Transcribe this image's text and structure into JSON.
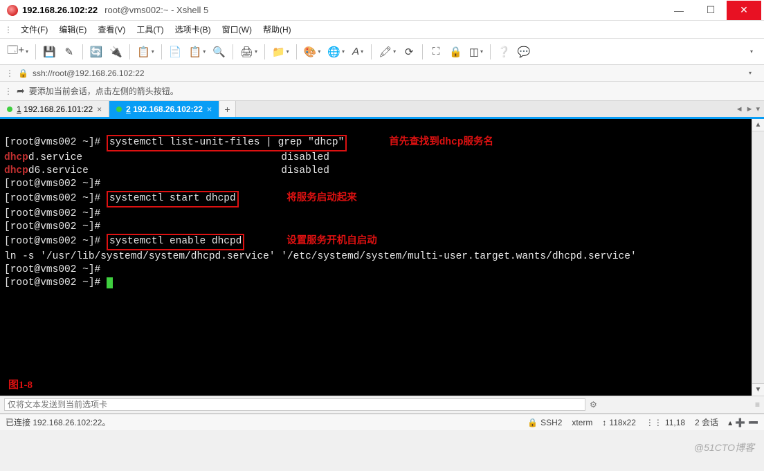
{
  "window": {
    "title": "192.168.26.102:22",
    "subtitle": "root@vms002:~ - Xshell 5"
  },
  "menus": [
    "文件(F)",
    "编辑(E)",
    "查看(V)",
    "工具(T)",
    "选项卡(B)",
    "窗口(W)",
    "帮助(H)"
  ],
  "address": "ssh://root@192.168.26.102:22",
  "hint": "要添加当前会话，点击左侧的箭头按钮。",
  "tabs": [
    {
      "num": "1",
      "label": "192.168.26.101:22",
      "active": false
    },
    {
      "num": "2",
      "label": "192.168.26.102:22",
      "active": true
    }
  ],
  "terminal": {
    "prompt": "[root@vms002 ~]#",
    "cmd1": "systemctl list-unit-files | grep \"dhcp\"",
    "anno1": "首先查找到dhcp服务名",
    "svc1a": "dhcp",
    "svc1b": "d.service",
    "svc1_state": "disabled",
    "svc2a": "dhcp",
    "svc2b": "d6.service",
    "svc2_state": "disabled",
    "cmd2": "systemctl start dhcpd",
    "anno2": "将服务启动起来",
    "cmd3": "systemctl enable dhcpd",
    "anno3": "设置服务开机自启动",
    "ln_out": "ln -s '/usr/lib/systemd/system/dhcpd.service' '/etc/systemd/system/multi-user.target.wants/dhcpd.service'",
    "figure_label": "图1-8"
  },
  "send_placeholder": "仅将文本发送到当前选项卡",
  "status": {
    "left": "已连接 192.168.26.102:22。",
    "ssh": "SSH2",
    "term": "xterm",
    "size": "118x22",
    "pos": "11,18",
    "sessions": "2 会话"
  },
  "watermark": "@51CTO博客"
}
